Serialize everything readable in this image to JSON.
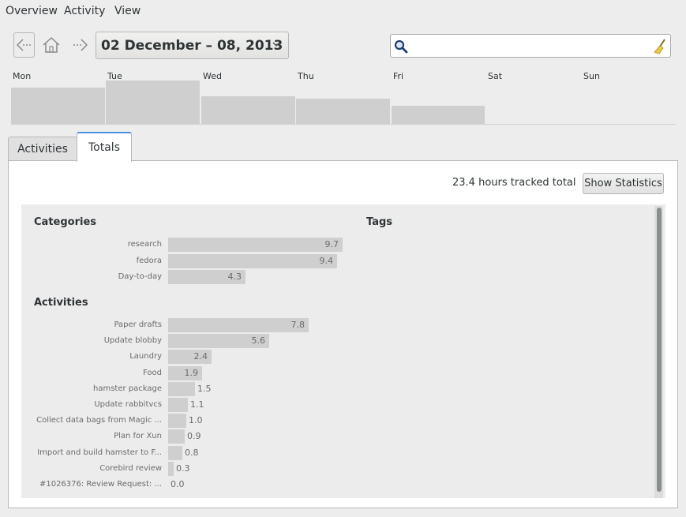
{
  "menu": {
    "items": [
      "Overview",
      "Activity",
      "View"
    ]
  },
  "nav": {
    "date_range": "02 December – 08, 2013"
  },
  "search": {
    "value": "",
    "placeholder": ""
  },
  "week": {
    "days": [
      {
        "label": "Mon",
        "hours": 5.5
      },
      {
        "label": "Tue",
        "hours": 6.6
      },
      {
        "label": "Wed",
        "hours": 4.2
      },
      {
        "label": "Thu",
        "hours": 3.9
      },
      {
        "label": "Fri",
        "hours": 2.8
      },
      {
        "label": "Sat",
        "hours": 0
      },
      {
        "label": "Sun",
        "hours": 0
      }
    ]
  },
  "tabs": [
    {
      "label": "Activities",
      "active": false
    },
    {
      "label": "Totals",
      "active": true
    }
  ],
  "totals": {
    "tracked_text": "23.4 hours tracked total",
    "stats_button": "Show Statistics",
    "categories_title": "Categories",
    "tags_title": "Tags",
    "activities_title": "Activities",
    "categories": [
      {
        "label": "research",
        "value": "9.7"
      },
      {
        "label": "fedora",
        "value": "9.4"
      },
      {
        "label": "Day-to-day",
        "value": "4.3"
      }
    ],
    "activities": [
      {
        "label": "Paper drafts",
        "value": "7.8"
      },
      {
        "label": "Update blobby",
        "value": "5.6"
      },
      {
        "label": "Laundry",
        "value": "2.4"
      },
      {
        "label": "Food",
        "value": "1.9"
      },
      {
        "label": "hamster package",
        "value": "1.5"
      },
      {
        "label": "Update rabbitvcs",
        "value": "1.1"
      },
      {
        "label": "Collect data bags from Magic ...",
        "value": "1.0"
      },
      {
        "label": "Plan for Xun",
        "value": "0.9"
      },
      {
        "label": "Import and build hamster to F...",
        "value": "0.8"
      },
      {
        "label": "Corebird review",
        "value": "0.3"
      },
      {
        "label": "#1026376: Review Request: ...",
        "value": "0.0"
      }
    ]
  }
}
